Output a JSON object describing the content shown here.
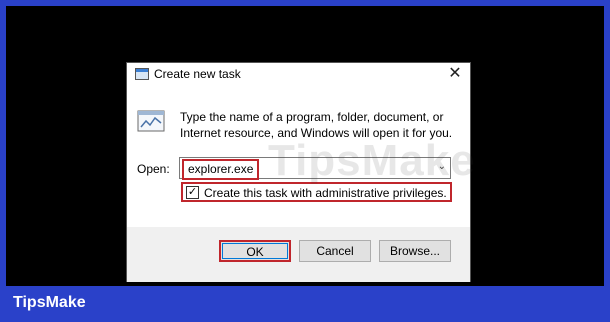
{
  "dialog": {
    "title": "Create new task",
    "close_glyph": "✕",
    "description": "Type the name of a program, folder, document, or Internet resource, and Windows will open it for you.",
    "open_label": "Open:",
    "open_value": "explorer.exe",
    "admin_checkbox": {
      "label": "Create this task with administrative privileges.",
      "checked": true,
      "check_glyph": "✓"
    },
    "buttons": {
      "ok": "OK",
      "cancel": "Cancel",
      "browse": "Browse..."
    }
  },
  "icons": {
    "title": "task-window-icon",
    "run": "run-program-icon",
    "dropdown": "chevron-down-icon"
  },
  "overlay": {
    "watermark": "TipsMake",
    "brand": "TipsMake"
  },
  "colors": {
    "frame": "#2a41c9",
    "highlight": "#c0262c",
    "focus": "#0078d7"
  }
}
